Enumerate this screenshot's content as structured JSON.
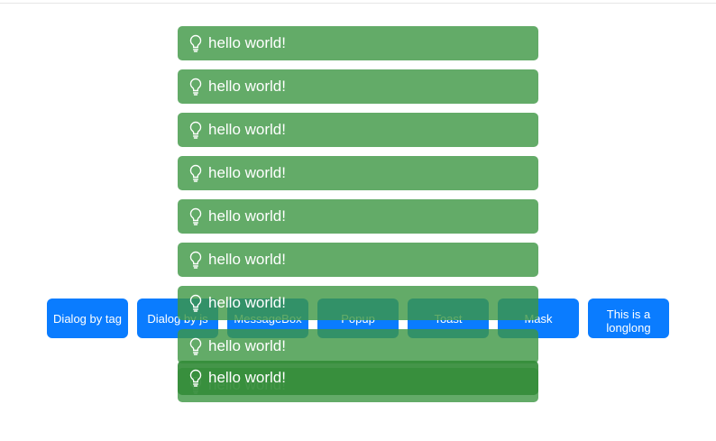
{
  "buttons": [
    {
      "label": "Dialog by tag"
    },
    {
      "label": "Dialog by js"
    },
    {
      "label": "MessageBox"
    },
    {
      "label": "Popup"
    },
    {
      "label": "Toast"
    },
    {
      "label": "Mask"
    },
    {
      "label": "This is a longlong"
    }
  ],
  "toasts": [
    {
      "icon": "lightbulb-icon",
      "text": "hello world!"
    },
    {
      "icon": "lightbulb-icon",
      "text": "hello world!"
    },
    {
      "icon": "lightbulb-icon",
      "text": "hello world!"
    },
    {
      "icon": "lightbulb-icon",
      "text": "hello world!"
    },
    {
      "icon": "lightbulb-icon",
      "text": "hello world!"
    },
    {
      "icon": "lightbulb-icon",
      "text": "hello world!"
    },
    {
      "icon": "lightbulb-icon",
      "text": "hello world!"
    },
    {
      "icon": "lightbulb-icon",
      "text": "hello world!"
    },
    {
      "icon": "lightbulb-icon",
      "text": "hello world!"
    },
    {
      "icon": "lightbulb-icon",
      "text": "hello world!"
    }
  ],
  "colors": {
    "button": "#0a7cff",
    "toast": "#3c9642",
    "text": "#ffffff"
  }
}
